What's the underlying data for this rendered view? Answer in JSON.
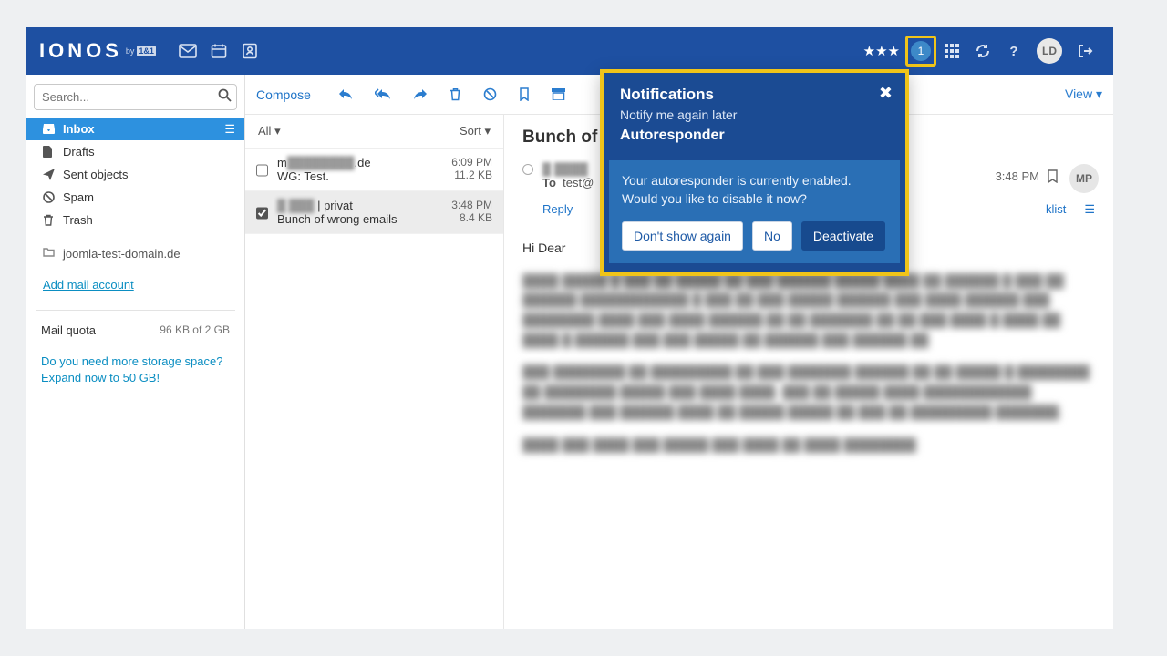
{
  "header": {
    "logo": "IONOS",
    "logo_sub_by": "by",
    "logo_sub_brand": "1&1",
    "badge_count": "1",
    "avatar_initials": "LD"
  },
  "search": {
    "placeholder": "Search..."
  },
  "folders": {
    "inbox": "Inbox",
    "drafts": "Drafts",
    "sent": "Sent objects",
    "spam": "Spam",
    "trash": "Trash"
  },
  "account_label": "joomla-test-domain.de",
  "add_account": "Add mail account",
  "quota": {
    "label": "Mail quota",
    "value": "96 KB of 2 GB"
  },
  "storage_cta": {
    "line1": "Do you need more storage space?",
    "line2": "Expand now to 50 GB!"
  },
  "toolbar": {
    "compose": "Compose",
    "view": "View"
  },
  "list_header": {
    "all": "All",
    "sort": "Sort"
  },
  "messages": [
    {
      "from_prefix": "m",
      "from_blur": "████████",
      "from_suffix": ".de",
      "subject": "WG: Test.",
      "time": "6:09 PM",
      "size": "11.2 KB",
      "selected": false
    },
    {
      "from_prefix": "",
      "from_blur": "█ ███",
      "from_suffix": " | privat",
      "subject": "Bunch of wrong emails",
      "time": "3:48 PM",
      "size": "8.4 KB",
      "selected": true
    }
  ],
  "reader": {
    "subject_visible": "Bunch of w",
    "to_label": "To",
    "to_value_prefix": "test@",
    "time": "3:48 PM",
    "avatar": "MP",
    "actions": {
      "reply": "Reply",
      "blocklist": "klist"
    },
    "greeting": "Hi Dear",
    "blur1": "████ █████ █ ███ ██ █████ ██ ███ ██████ █████ ████ ██ ██████ █ ███ ██ ██████ ████████████  █ ███ ██ ███ █████ ██████ ███ ████ ██████ ███ ████████ ████ ███ ████ ██████ ██ ██ ███████ ██ ██ ███ ████  █ ████ ██ ████ █ ██████ ███ ███ █████ ██ ██████ ███ ██████ ██",
    "blur2": "███ ████████ ██ █████████ ██ ███ ███████ ██████ ██ ██ █████ █ ████████ ██ ████████ █████ ███ ████ ████. ███ ██ █████ ████ ████████████ ███████ ███ ██████ ████ ██ █████ █████ ██ ███ ██ █████████ ███████.",
    "blur3": "████ ███ ████ ███ █████ ███ ████ ██ ████ ████████"
  },
  "popover": {
    "title": "Notifications",
    "subtitle": "Notify me again later",
    "section_title": "Autoresponder",
    "line1": "Your autoresponder is currently enabled.",
    "line2": "Would you like to disable it now?",
    "btn_dontshow": "Don't show again",
    "btn_no": "No",
    "btn_deactivate": "Deactivate"
  }
}
